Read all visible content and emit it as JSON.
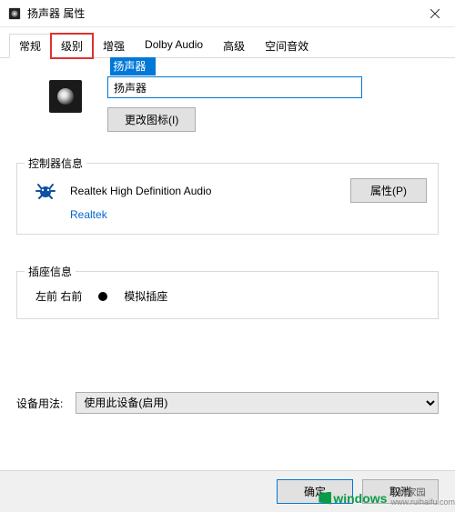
{
  "window": {
    "title": "扬声器 属性"
  },
  "tabs": [
    {
      "label": "常规",
      "active": true,
      "highlight": false
    },
    {
      "label": "级别",
      "active": false,
      "highlight": true
    },
    {
      "label": "增强",
      "active": false,
      "highlight": false
    },
    {
      "label": "Dolby Audio",
      "active": false,
      "highlight": false
    },
    {
      "label": "高级",
      "active": false,
      "highlight": false
    },
    {
      "label": "空间音效",
      "active": false,
      "highlight": false
    }
  ],
  "general": {
    "device_name": "扬声器",
    "change_icon_label": "更改图标(I)"
  },
  "controller": {
    "group_label": "控制器信息",
    "name": "Realtek High Definition Audio",
    "vendor": "Realtek",
    "properties_label": "属性(P)"
  },
  "jack": {
    "group_label": "插座信息",
    "position": "左前 右前",
    "type": "模拟插座"
  },
  "usage": {
    "label": "设备用法:",
    "selected": "使用此设备(启用)"
  },
  "footer": {
    "ok": "确定",
    "cancel": "取消"
  },
  "watermark": {
    "brand": "windows",
    "suffix": "系统家园",
    "url": "www.ruihaifu.com"
  }
}
